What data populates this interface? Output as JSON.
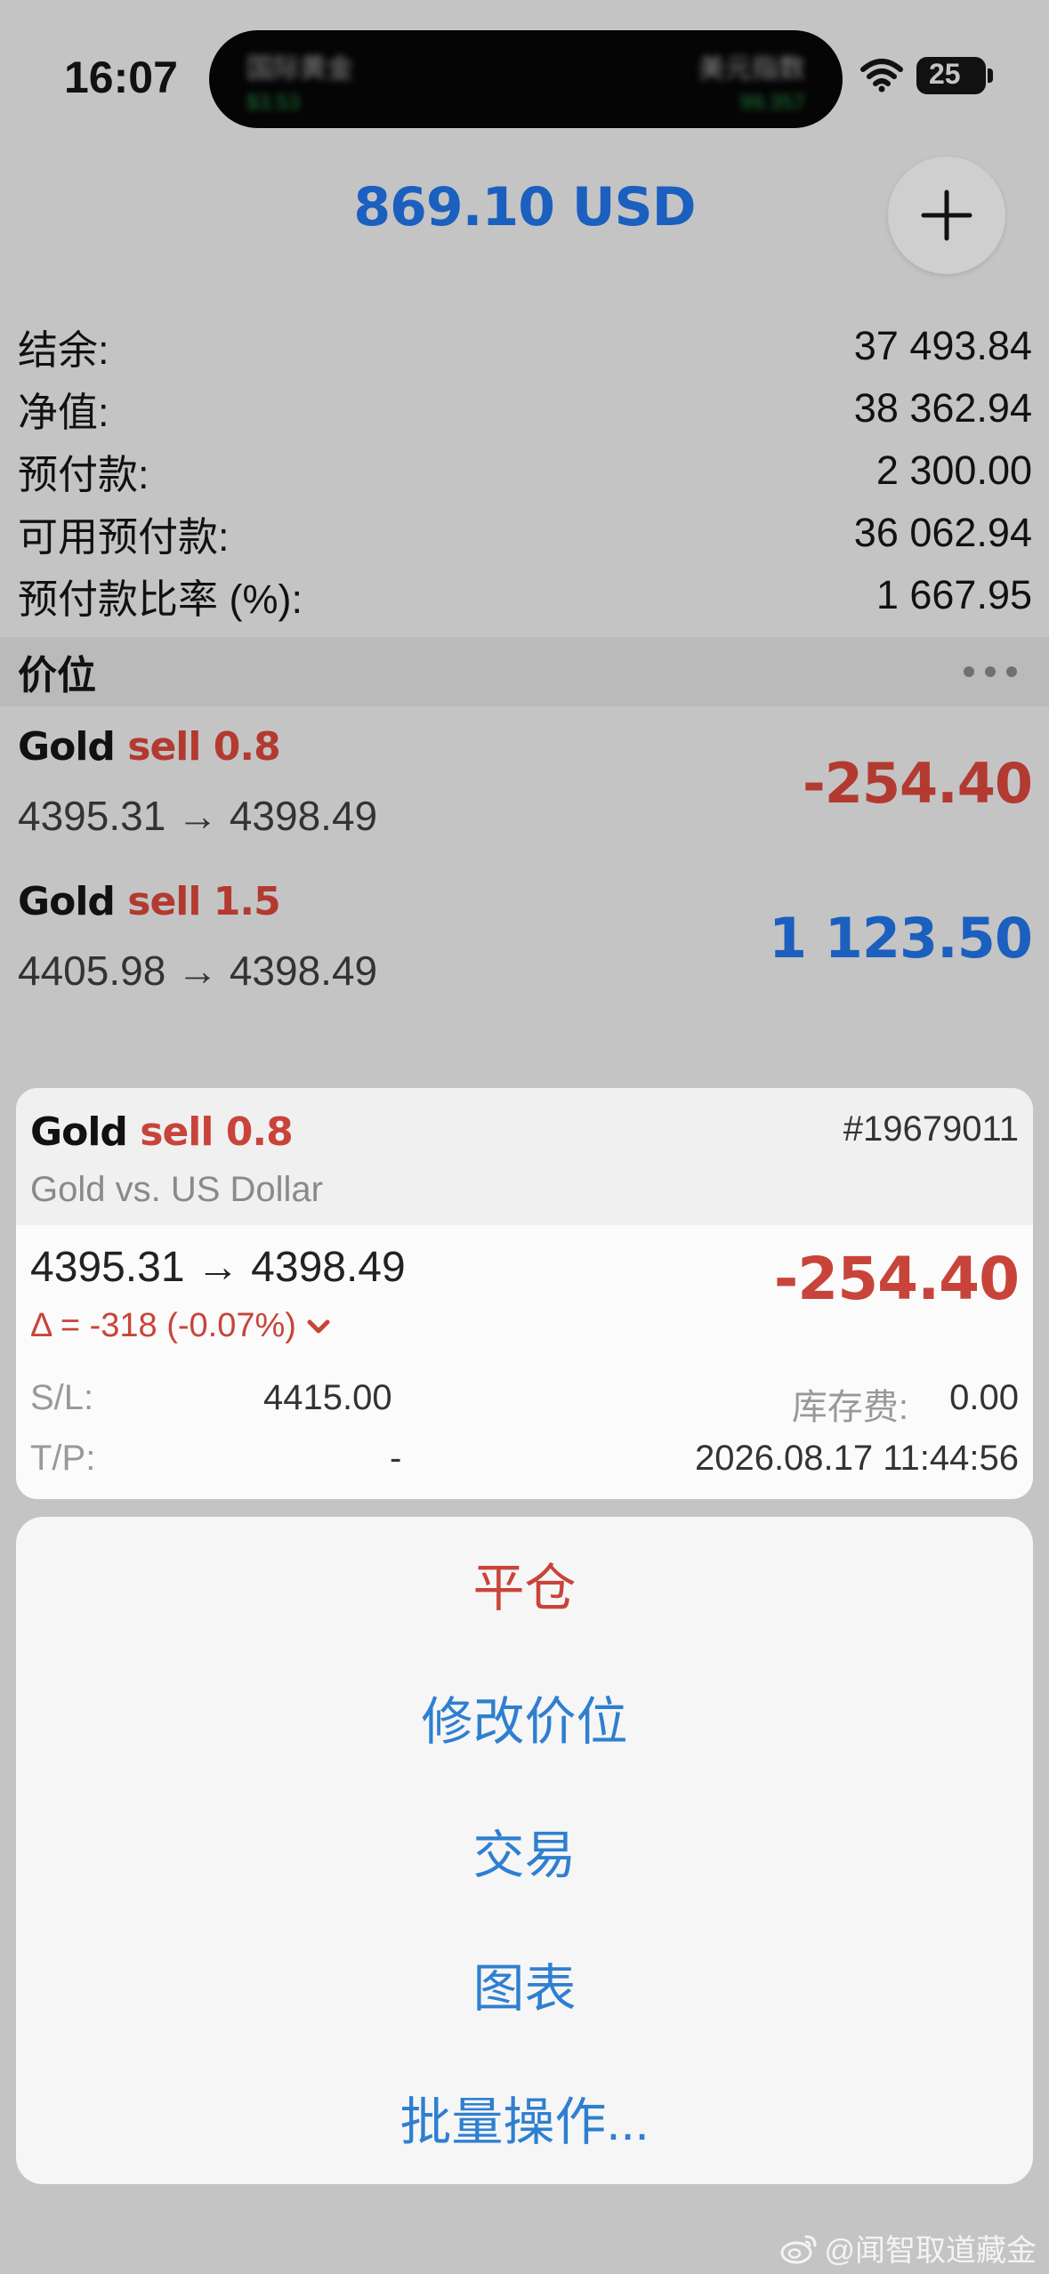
{
  "status_bar": {
    "time": "16:07",
    "island_left_title": "国际黄金",
    "island_left_value": "$3.53",
    "island_right_title": "美元指数",
    "island_right_value": "99.357",
    "battery": "25"
  },
  "header": {
    "amount": "869.10 USD"
  },
  "summary": [
    {
      "label": "结余:",
      "value": "37 493.84"
    },
    {
      "label": "净值:",
      "value": "38 362.94"
    },
    {
      "label": "预付款:",
      "value": "2 300.00"
    },
    {
      "label": "可用预付款:",
      "value": "36 062.94"
    },
    {
      "label": "预付款比率 (%):",
      "value": "1 667.95"
    }
  ],
  "positions_section": {
    "title": "价位"
  },
  "positions": [
    {
      "symbol": "Gold",
      "side": "sell 0.8",
      "prices": "4395.31 → 4398.49",
      "profit": "-254.40"
    },
    {
      "symbol": "Gold",
      "side": "sell 1.5",
      "prices": "4405.98 → 4398.49",
      "profit": "1 123.50"
    }
  ],
  "detail": {
    "symbol": "Gold",
    "side": "sell 0.8",
    "ticket": "#19679011",
    "description": "Gold vs. US Dollar",
    "prices": "4395.31 → 4398.49",
    "delta": "Δ = -318 (-0.07%)",
    "profit": "-254.40",
    "sl_label": "S/L:",
    "sl_value": "4415.00",
    "tp_label": "T/P:",
    "tp_value": "-",
    "swap_label": "库存费:",
    "swap_value": "0.00",
    "open_time": "2026.08.17 11:44:56"
  },
  "actions": {
    "close": "平仓",
    "modify": "修改价位",
    "trade": "交易",
    "chart": "图表",
    "bulk": "批量操作..."
  },
  "watermark": {
    "text": "@闻智取道藏金"
  },
  "colors": {
    "blue": "#1b5fbf",
    "red": "#b33a30",
    "action_blue": "#2f7fd0"
  }
}
